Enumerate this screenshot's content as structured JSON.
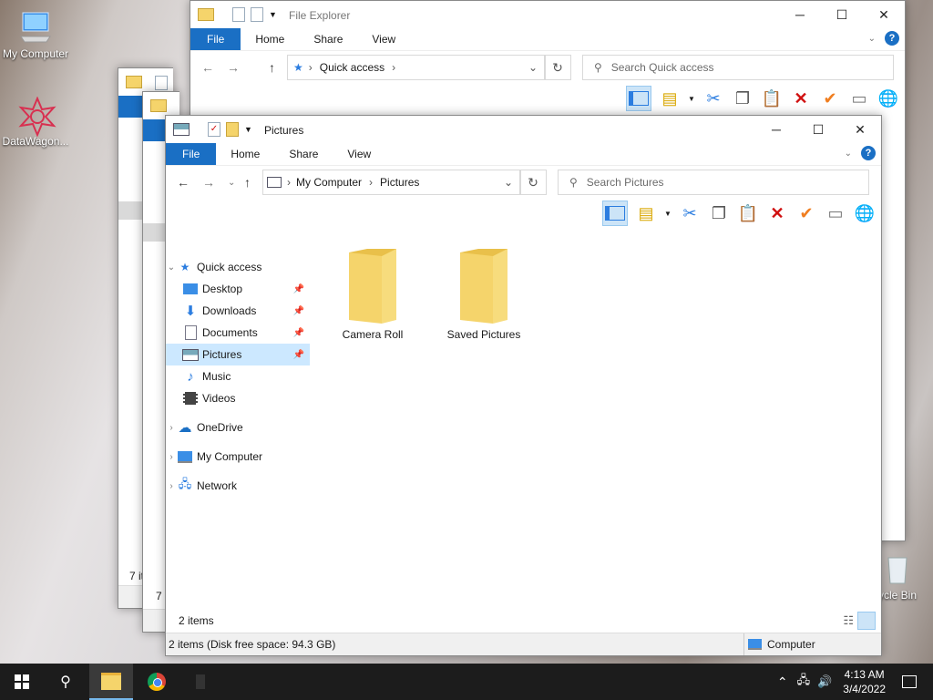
{
  "desktop": {
    "icons": [
      {
        "label": "My Computer"
      },
      {
        "label": "DataWagon..."
      },
      {
        "label": "ycle Bin"
      }
    ]
  },
  "back_window_1": {
    "title": "File Explorer",
    "tabs": [
      "File",
      "Home",
      "Share",
      "View"
    ],
    "address": "Quick access",
    "search_placeholder": "Search Quick access"
  },
  "back_window_2": {
    "status": "7 ite"
  },
  "back_window_3": {
    "status": "7 it"
  },
  "main_window": {
    "title": "Pictures",
    "tabs": [
      "File",
      "Home",
      "Share",
      "View"
    ],
    "breadcrumb": [
      "My Computer",
      "Pictures"
    ],
    "search_placeholder": "Search Pictures",
    "nav": {
      "quick_access": "Quick access",
      "items": [
        "Desktop",
        "Downloads",
        "Documents",
        "Pictures",
        "Music",
        "Videos"
      ],
      "onedrive": "OneDrive",
      "my_computer": "My Computer",
      "network": "Network"
    },
    "folders": [
      "Camera Roll",
      "Saved Pictures"
    ],
    "status": "2 items",
    "details_left": "2 items (Disk free space: 94.3 GB)",
    "details_right": "Computer"
  },
  "taskbar": {
    "time": "4:13 AM",
    "date": "3/4/2022"
  },
  "colors": {
    "accent": "#1a6fc4",
    "folder": "#f5d46b",
    "selection": "#cce8ff"
  }
}
